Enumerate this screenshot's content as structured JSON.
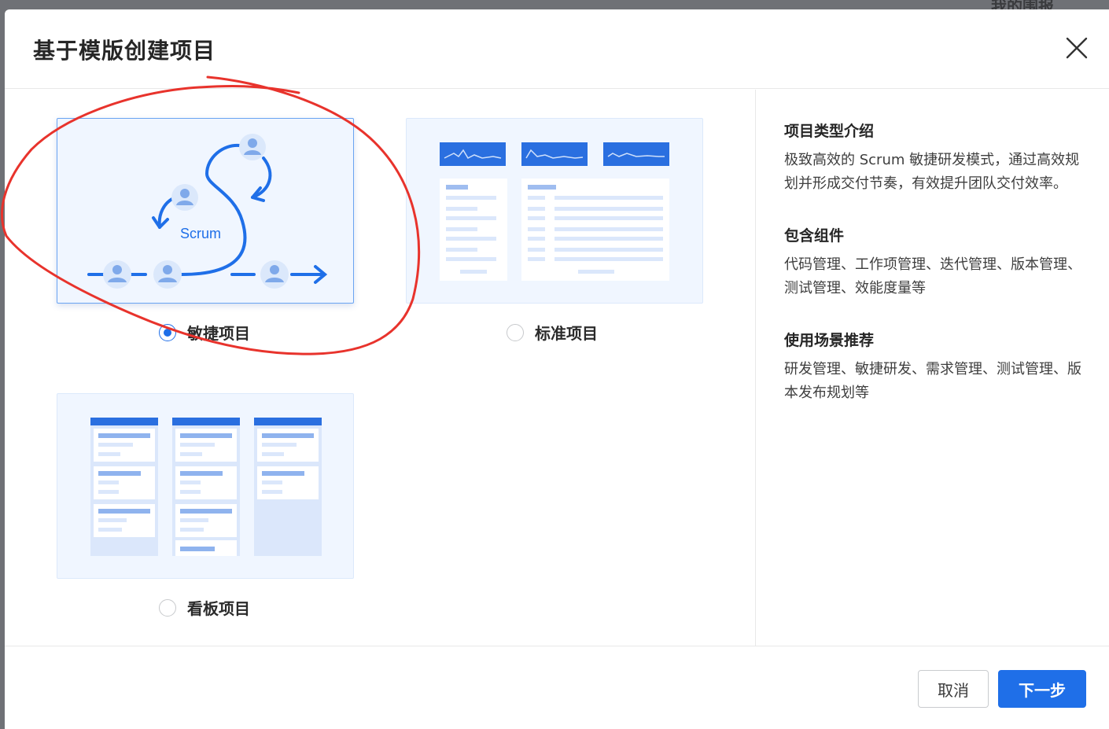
{
  "background": {
    "title": "我的围报"
  },
  "dialog": {
    "title": "基于模版创建项目",
    "close_icon": "close-icon"
  },
  "options": [
    {
      "label": "敏捷项目",
      "checked": true,
      "logo_text": "Scrum"
    },
    {
      "label": "标准项目",
      "checked": false
    },
    {
      "label": "看板项目",
      "checked": false
    }
  ],
  "details": [
    {
      "title": "项目类型介绍",
      "body": "极致高效的 Scrum 敏捷研发模式，通过高效规划并形成交付节奏，有效提升团队交付效率。"
    },
    {
      "title": "包含组件",
      "body": "代码管理、工作项管理、迭代管理、版本管理、测试管理、效能度量等"
    },
    {
      "title": "使用场景推荐",
      "body": "研发管理、敏捷研发、需求管理、测试管理、版本发布规划等"
    }
  ],
  "footer": {
    "cancel": "取消",
    "next": "下一步"
  },
  "colors": {
    "accent": "#1f6fe8",
    "annotation": "#e8332c"
  }
}
